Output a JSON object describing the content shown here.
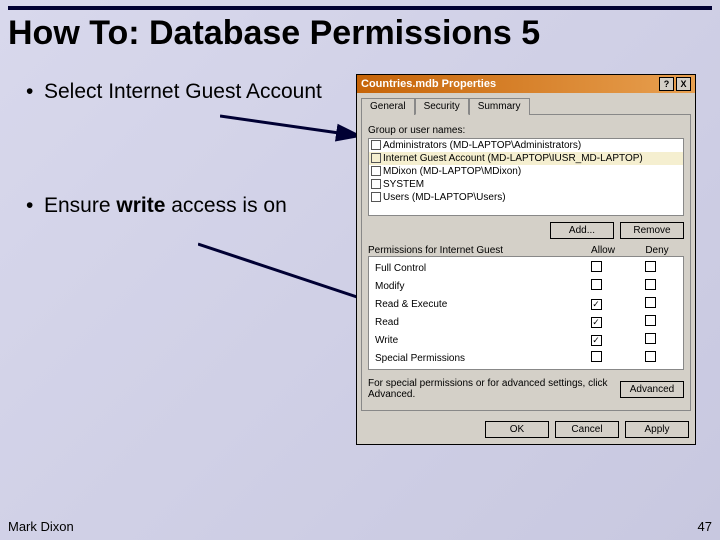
{
  "slide": {
    "title": "How To: Database Permissions 5",
    "bullets": [
      {
        "text": "Select Internet Guest Account"
      },
      {
        "text_pre": "Ensure ",
        "text_bold": "write",
        "text_post": " access is on"
      }
    ],
    "author": "Mark Dixon",
    "page": "47"
  },
  "dialog": {
    "title": "Countries.mdb Properties",
    "help": "?",
    "close": "X",
    "tabs": {
      "general": "General",
      "security": "Security",
      "summary": "Summary"
    },
    "group_label": "Group or user names:",
    "users": [
      "Administrators (MD-LAPTOP\\Administrators)",
      "Internet Guest Account (MD-LAPTOP\\IUSR_MD-LAPTOP)",
      "MDixon (MD-LAPTOP\\MDixon)",
      "SYSTEM",
      "Users (MD-LAPTOP\\Users)"
    ],
    "add": "Add...",
    "remove": "Remove",
    "perm_header": "Permissions for Internet Guest",
    "allow": "Allow",
    "deny": "Deny",
    "perms": [
      {
        "name": "Full Control",
        "allow": false,
        "deny": false
      },
      {
        "name": "Modify",
        "allow": false,
        "deny": false
      },
      {
        "name": "Read & Execute",
        "allow": true,
        "deny": false
      },
      {
        "name": "Read",
        "allow": true,
        "deny": false
      },
      {
        "name": "Write",
        "allow": true,
        "deny": false
      },
      {
        "name": "Special Permissions",
        "allow": false,
        "deny": false
      }
    ],
    "adv_text": "For special permissions or for advanced settings, click Advanced.",
    "advanced": "Advanced",
    "ok": "OK",
    "cancel": "Cancel",
    "apply": "Apply"
  }
}
